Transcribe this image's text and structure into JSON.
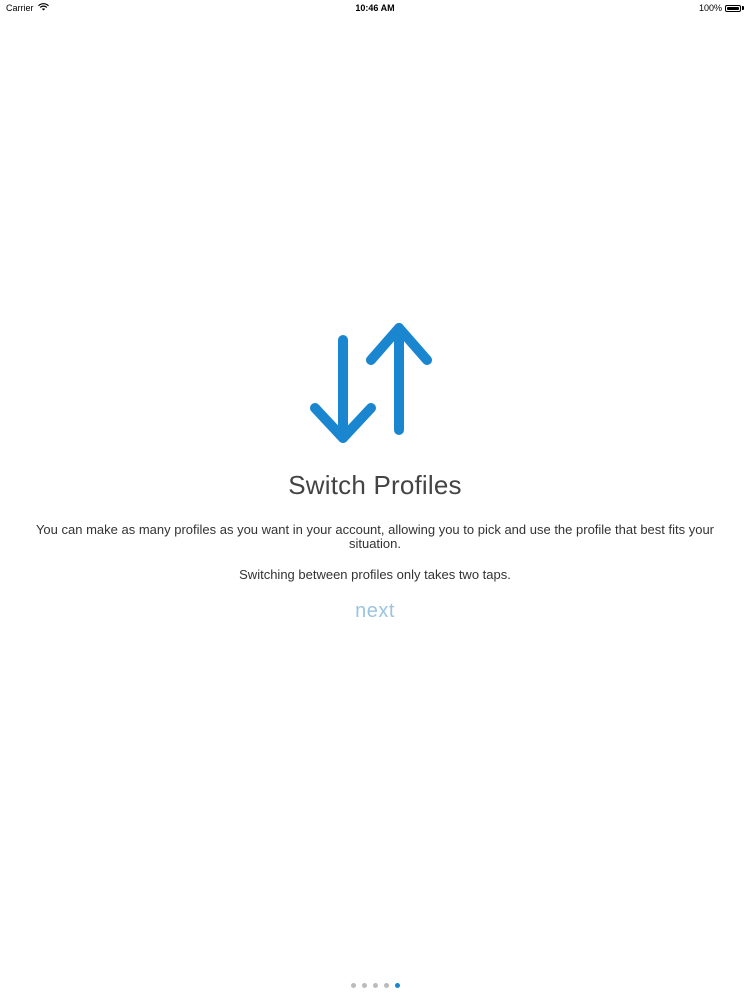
{
  "status_bar": {
    "carrier": "Carrier",
    "time": "10:46 AM",
    "battery": "100%",
    "battery_level": 1.0
  },
  "onboarding": {
    "icon": "switch-arrows-icon",
    "accent_color": "#1a86cf",
    "title": "Switch Profiles",
    "description": "You can make as many profiles as you want in your account, allowing you to pick and use the profile that best fits your situation.",
    "description_2": "Switching between profiles only takes two taps.",
    "next_label": "next"
  },
  "pagination": {
    "total": 5,
    "active_index": 4
  }
}
